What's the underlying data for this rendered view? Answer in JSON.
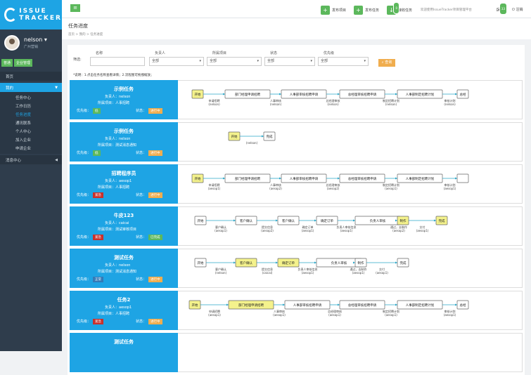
{
  "logo": {
    "line1": "ISSUE",
    "line2": "TRACKER"
  },
  "user": {
    "name": "nelson ▾",
    "dept": "广州营销"
  },
  "roles": [
    "普通",
    "企业管理"
  ],
  "nav": {
    "home": "首页",
    "mine": "我的",
    "sub": [
      "任务中心",
      "工作日历",
      "任务进度",
      "通讯联系",
      "个人中心",
      "加入企业",
      "申请企业"
    ],
    "messages": "消息中心"
  },
  "topbar": {
    "btn1": "发布项目",
    "btn2": "发布任务",
    "btn3": "接收任务",
    "badge3": "0",
    "welcome": "欢迎使用IssueTracker项目管理平台",
    "bell_badge": "33",
    "logout": "注销"
  },
  "page": {
    "title": "任务进度",
    "breadcrumb": "首页 > 我的 > 任务进度"
  },
  "filter": {
    "label": "筛选:",
    "name_label": "名称",
    "owner_label": "负责人",
    "project_label": "所属项目",
    "status_label": "状态",
    "priority_label": "优先级",
    "all": "全部",
    "search": "查询"
  },
  "note": "*说明：1.点击任务名称查看详情；2.流程图可拖拽缩放；",
  "tasks": [
    {
      "title": "示例任务",
      "owner": "负责人：nelson",
      "project": "所属项目：人事招聘",
      "prio_label": "优先级：",
      "prio": "低",
      "prio_color": "#5cb85c",
      "status_label": "状态：",
      "status": "进行中",
      "status_color": "#f0ad4e",
      "nodes": [
        {
          "label": "开始",
          "hl": true,
          "cap": ""
        },
        {
          "label": "部门经理申请招聘",
          "hl": false,
          "cap": "申请招聘\n(nelson)"
        },
        {
          "label": "人事部审核招聘申请",
          "hl": false,
          "cap": "人事审核\n(nelson)"
        },
        {
          "label": "总经理审核招聘申请",
          "hl": false,
          "cap": "总经理审核\n(nelson)"
        },
        {
          "label": "人事部制定招聘计划",
          "hl": false,
          "cap": "制定招聘计划\n(nelson)"
        },
        {
          "label": "总经",
          "hl": false,
          "cap": "审核计划\n(nelson)"
        }
      ]
    },
    {
      "title": "示例任务",
      "owner": "负责人：nelson",
      "project": "所属项目：测试消息通知",
      "prio_label": "优先级：",
      "prio": "低",
      "prio_color": "#5cb85c",
      "status_label": "状态：",
      "status": "进行中",
      "status_color": "#f0ad4e",
      "nodes": [
        {
          "label": "开始",
          "hl": true,
          "cap": ""
        },
        {
          "label": "完成",
          "hl": false,
          "cap": "(nelson)"
        }
      ]
    },
    {
      "title": "招聘程序员",
      "owner": "负责人：aesop1",
      "project": "所属项目：人事招聘",
      "prio_label": "优先级：",
      "prio": "紧急",
      "prio_color": "#c9302c",
      "status_label": "状态：",
      "status": "进行中",
      "status_color": "#f0ad4e",
      "nodes": [
        {
          "label": "开始",
          "hl": true,
          "cap": ""
        },
        {
          "label": "部门经理申请招聘",
          "hl": false,
          "cap": "申请招聘\n(aesop1)"
        },
        {
          "label": "人事部审核招聘申请",
          "hl": false,
          "cap": "人事审核\n(aesop2)"
        },
        {
          "label": "总经理审核招聘申请",
          "hl": false,
          "cap": "总经理审核\n(aesop2)"
        },
        {
          "label": "人事部制定招聘计划",
          "hl": false,
          "cap": "制定招聘计划\n(aesop1)"
        },
        {
          "label": "",
          "hl": false,
          "cap": "审核计划\n(aesop1)"
        }
      ]
    },
    {
      "title": "牛皮123",
      "owner": "负责人：caicai",
      "project": "所属项目：测试审核项目",
      "prio_label": "优先级：",
      "prio": "紧急",
      "prio_color": "#c9302c",
      "status_label": "状态：",
      "status": "已完成",
      "status_color": "#5cb85c",
      "nodes": [
        {
          "label": "开始",
          "hl": false,
          "cap": ""
        },
        {
          "label": "客户确认",
          "hl": false,
          "cap": "客户确认\n(aesop1)"
        },
        {
          "label": "客户确认",
          "hl": false,
          "cap": "提交信息\n(aesop2)"
        },
        {
          "label": "确定订单",
          "hl": false,
          "cap": "确定订单\n(aesop1)"
        },
        {
          "label": "负责人审核",
          "hl": false,
          "cap": "负责人审核信息\n(aesop1)"
        },
        {
          "label": "制作",
          "hl": true,
          "cap": "通过，去制作\n(aesop2)"
        },
        {
          "label": "完成",
          "hl": true,
          "cap": "交付\n(aesop1)"
        }
      ]
    },
    {
      "title": "测试任务",
      "owner": "负责人：nelson",
      "project": "所属项目：测试消息通知",
      "prio_label": "优先级：",
      "prio": "正常",
      "prio_color": "#337ab7",
      "status_label": "状态：",
      "status": "进行中",
      "status_color": "#f0ad4e",
      "nodes": [
        {
          "label": "开始",
          "hl": false,
          "cap": ""
        },
        {
          "label": "客户确认",
          "hl": true,
          "cap": "客户确认\n(nelson)"
        },
        {
          "label": "确定订单",
          "hl": true,
          "cap": "提交信息\n(caicai)"
        },
        {
          "label": "负责人审核",
          "hl": false,
          "cap": "负责人审核信息\n(aesop1)"
        },
        {
          "label": "制作",
          "hl": false,
          "cap": "通过，去制作\n(aesop1)"
        },
        {
          "label": "完成",
          "hl": false,
          "cap": "交付\n(aesop1)"
        }
      ]
    },
    {
      "title": "任务2",
      "owner": "负责人：aesop1",
      "project": "所属项目：人事招聘",
      "prio_label": "优先级：",
      "prio": "紧急",
      "prio_color": "#c9302c",
      "status_label": "状态：",
      "status": "进行中",
      "status_color": "#f0ad4e",
      "nodes": [
        {
          "label": "开始",
          "hl": true,
          "cap": ""
        },
        {
          "label": "部门经理申请招聘",
          "hl": true,
          "cap": "申请招聘\n(aesop1)"
        },
        {
          "label": "人事部审核招聘申请",
          "hl": false,
          "cap": "人事审核\n(aesop1)"
        },
        {
          "label": "总经理审核招聘申请",
          "hl": false,
          "cap": "总经理审核\n(aesop1)"
        },
        {
          "label": "人事部制定招聘计划",
          "hl": false,
          "cap": "制定招聘计划\n(aesop1)"
        },
        {
          "label": "总经",
          "hl": false,
          "cap": "审核计划\n(aesop1)"
        }
      ]
    },
    {
      "title": "测试任务",
      "owner": "",
      "project": "",
      "prio_label": "",
      "prio": "",
      "prio_color": "#c9302c",
      "status_label": "",
      "status": "",
      "status_color": "#f0ad4e",
      "nodes": []
    }
  ]
}
